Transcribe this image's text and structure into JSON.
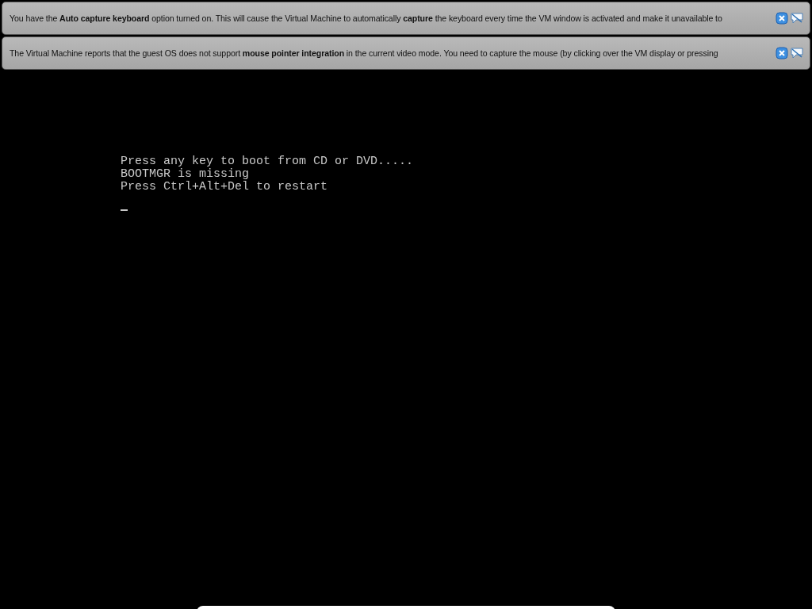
{
  "notifications": [
    {
      "message": "You have the **Auto capture keyboard** option turned on. This will cause the Virtual Machine to automatically **capture** the keyboard every time the VM window is activated and make it unavailable to"
    },
    {
      "message": "The Virtual Machine reports that the guest OS does not support **mouse pointer integration** in the current video mode. You need to capture the mouse (by clicking over the VM display or pressing"
    }
  ],
  "console": {
    "lines": [
      "Press any key to boot from CD or DVD.....",
      "BOOTMGR is missing",
      "Press Ctrl+Alt+Del to restart"
    ]
  }
}
